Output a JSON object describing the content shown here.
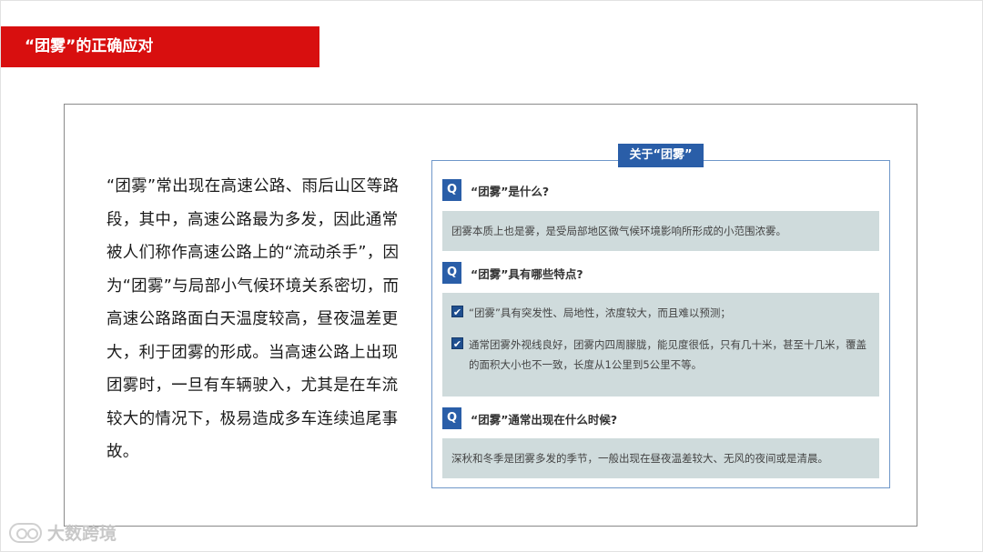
{
  "slide": {
    "title": "“团雾”的正确应对"
  },
  "body": {
    "paragraph": "“团雾”常出现在高速公路、雨后山区等路段，其中，高速公路最为多发，因此通常被人们称作高速公路上的“流动杀手”，因为“团雾”与局部小气候环境关系密切，而高速公路路面白天温度较高，昼夜温差更大，利于团雾的形成。当高速公路上出现团雾时，一旦有车辆驶入，尤其是在车流较大的情况下，极易造成多车连续追尾事故。"
  },
  "panel": {
    "header": "关于“团雾”",
    "questions": [
      {
        "badge": "Q",
        "question": "“团雾”是什么?",
        "answer": "团雾本质上也是雾，是受局部地区微气候环境影响所形成的小范围浓雾。"
      },
      {
        "badge": "Q",
        "question": "“团雾”具有哪些特点?",
        "points": [
          "“团雾”具有突发性、局地性，浓度较大，而且难以预测；",
          "通常团雾外视线良好，团雾内四周朦胧，能见度很低，只有几十米，甚至十几米，覆盖的面积大小也不一致，长度从1公里到5公里不等。"
        ]
      },
      {
        "badge": "Q",
        "question": "“团雾”通常出现在什么时候?",
        "answer": "深秋和冬季是团雾多发的季节，一般出现在昼夜温差较大、无风的夜间或是清晨。"
      }
    ],
    "check_mark": "✔"
  },
  "watermark": {
    "text": "大数跨境"
  }
}
